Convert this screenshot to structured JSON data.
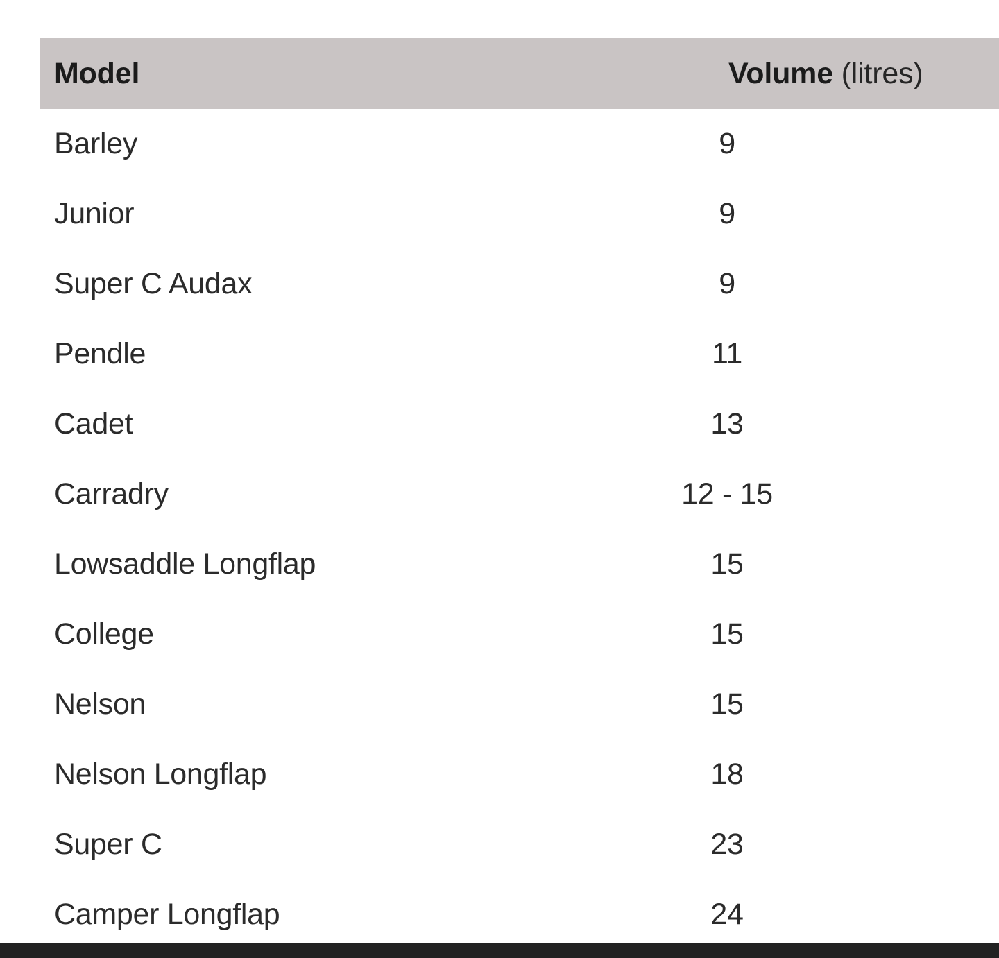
{
  "table": {
    "columns": [
      {
        "key": "model",
        "label": "Model",
        "label_strong": "Model",
        "label_light": ""
      },
      {
        "key": "volume",
        "label": "Volume (litres)",
        "label_strong": "Volume",
        "label_light": " (litres)"
      }
    ],
    "rows": [
      {
        "model": "Barley",
        "volume": "9"
      },
      {
        "model": "Junior",
        "volume": "9"
      },
      {
        "model": "Super C Audax",
        "volume": "9"
      },
      {
        "model": "Pendle",
        "volume": "11"
      },
      {
        "model": "Cadet",
        "volume": "13"
      },
      {
        "model": "Carradry",
        "volume": "12 - 15"
      },
      {
        "model": "Lowsaddle Longflap",
        "volume": "15"
      },
      {
        "model": "College",
        "volume": "15"
      },
      {
        "model": "Nelson",
        "volume": "15"
      },
      {
        "model": "Nelson Longflap",
        "volume": "18"
      },
      {
        "model": "Super C",
        "volume": "23"
      },
      {
        "model": "Camper Longflap",
        "volume": "24"
      }
    ]
  },
  "colors": {
    "header_background": "#C9C4C4",
    "header_text": "#1B1B1B",
    "body_text": "#2B2B2B",
    "page_background": "#FFFFFF",
    "bottom_bar": "#222222"
  }
}
